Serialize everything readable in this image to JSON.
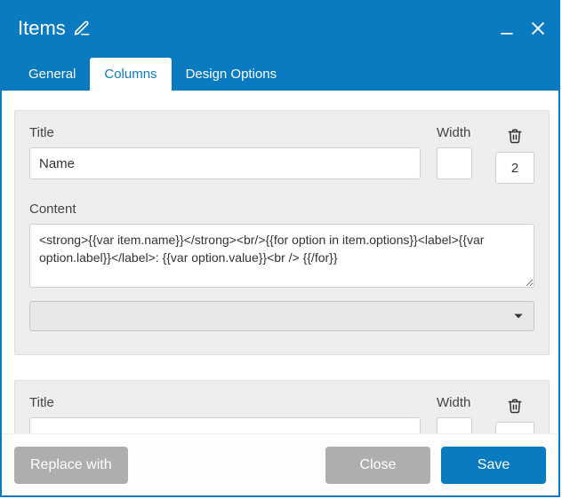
{
  "header": {
    "title": "Items"
  },
  "tabs": {
    "general": "General",
    "columns": "Columns",
    "design": "Design Options"
  },
  "fields": {
    "title_label": "Title",
    "width_label": "Width",
    "content_label": "Content"
  },
  "rows": [
    {
      "title_value": "Name",
      "width_value": "",
      "extra_value": "2",
      "content_value": "<strong>{{var item.name}}</strong><br/>{{for option in item.options}}<label>{{var option.label}}</label>: {{var option.value}}<br /> {{/for}}",
      "select_value": ""
    },
    {
      "title_value": "",
      "width_value": "",
      "extra_value": "",
      "content_value": "",
      "select_value": ""
    }
  ],
  "footer": {
    "replace": "Replace with",
    "close": "Close",
    "save": "Save"
  },
  "colors": {
    "primary": "#0b7bc1",
    "gray_btn": "#aeaeae",
    "panel_bg": "#eeeeee"
  }
}
